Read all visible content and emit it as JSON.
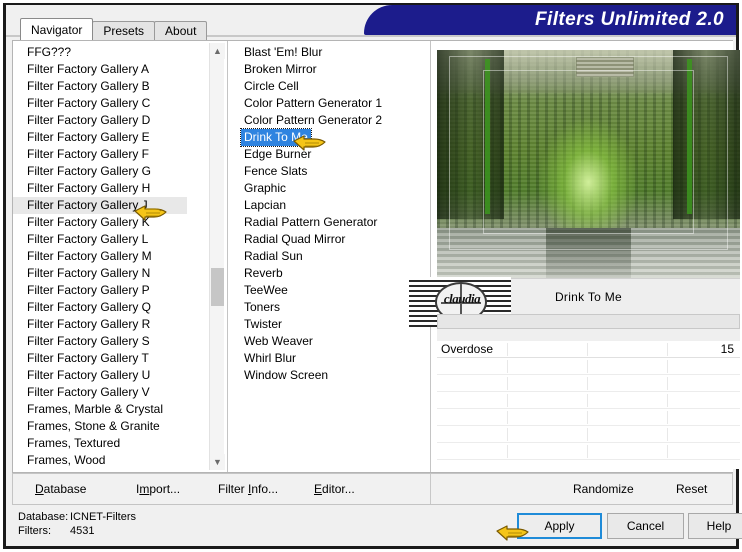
{
  "window": {
    "title": "Filters Unlimited 2.0",
    "title_color": "#1c1c8c"
  },
  "tabs": [
    {
      "label": "Navigator",
      "active": true
    },
    {
      "label": "Presets",
      "active": false
    },
    {
      "label": "About",
      "active": false
    }
  ],
  "categories": {
    "selected": "Filter Factory Gallery J",
    "items": [
      "FFG???",
      "Filter Factory Gallery A",
      "Filter Factory Gallery B",
      "Filter Factory Gallery C",
      "Filter Factory Gallery D",
      "Filter Factory Gallery E",
      "Filter Factory Gallery F",
      "Filter Factory Gallery G",
      "Filter Factory Gallery H",
      "Filter Factory Gallery J",
      "Filter Factory Gallery K",
      "Filter Factory Gallery L",
      "Filter Factory Gallery M",
      "Filter Factory Gallery N",
      "Filter Factory Gallery P",
      "Filter Factory Gallery Q",
      "Filter Factory Gallery R",
      "Filter Factory Gallery S",
      "Filter Factory Gallery T",
      "Filter Factory Gallery U",
      "Filter Factory Gallery V",
      "Frames, Marble & Crystal",
      "Frames, Stone & Granite",
      "Frames, Textured",
      "Frames, Wood"
    ]
  },
  "filters": {
    "selected": "Drink To Me",
    "items": [
      "Blast 'Em! Blur",
      "Broken Mirror",
      "Circle Cell",
      "Color Pattern Generator 1",
      "Color Pattern Generator 2",
      "Drink To Me",
      "Edge Burner",
      "Fence Slats",
      "Graphic",
      "Lapcian",
      "Radial Pattern Generator",
      "Radial Quad Mirror",
      "Radial Sun",
      "Reverb",
      "TeeWee",
      "Toners",
      "Twister",
      "Web Weaver",
      "Whirl Blur",
      "Window Screen"
    ]
  },
  "preview": {
    "effect_title": "Drink To Me",
    "watermark_text": "claudia"
  },
  "parameters": [
    {
      "name": "Overdose",
      "value": "15"
    },
    {
      "name": "",
      "value": ""
    },
    {
      "name": "",
      "value": ""
    },
    {
      "name": "",
      "value": ""
    },
    {
      "name": "",
      "value": ""
    },
    {
      "name": "",
      "value": ""
    },
    {
      "name": "",
      "value": ""
    }
  ],
  "action_bar": {
    "database": "Database",
    "import": "Import...",
    "filter_info": "Filter Info...",
    "editor": "Editor...",
    "randomize": "Randomize",
    "reset": "Reset"
  },
  "status": {
    "database_label": "Database:",
    "database_value": "ICNET-Filters",
    "filters_label": "Filters:",
    "filters_value": "4531"
  },
  "buttons": {
    "apply": "Apply",
    "cancel": "Cancel",
    "help": "Help"
  },
  "cursors": {
    "category_hand": "pointing-hand-cursor",
    "filter_hand": "pointing-hand-cursor",
    "apply_hand": "pointing-hand-cursor"
  },
  "scrollbar": {
    "up_glyph": "▲",
    "down_glyph": "▼"
  }
}
